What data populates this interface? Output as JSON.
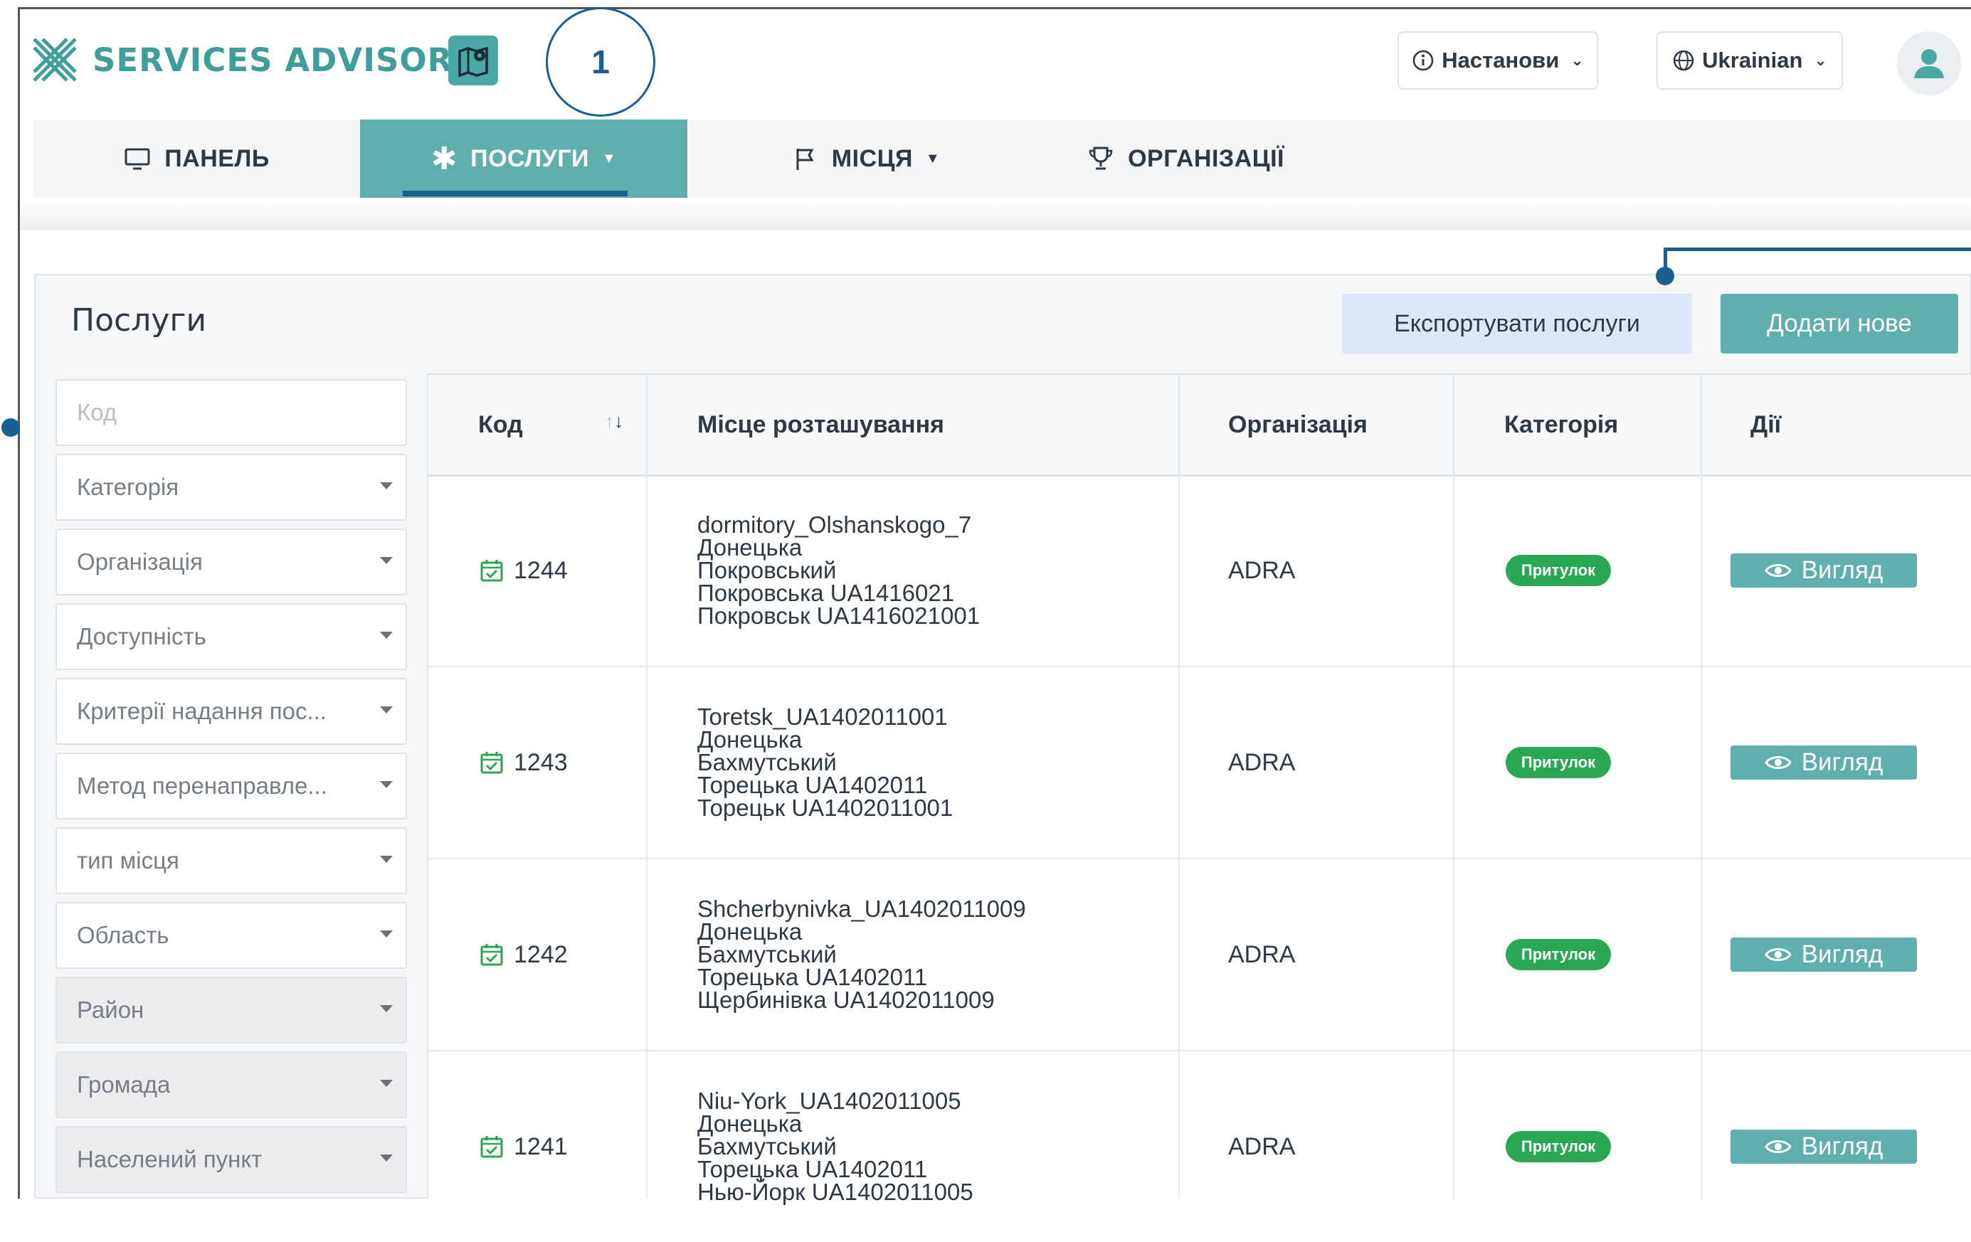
{
  "app": {
    "title": "SERVICES ADVISOR",
    "callout_number": "1"
  },
  "header": {
    "settings_label": "Настанови",
    "language_label": "Ukrainian"
  },
  "nav": {
    "items": [
      {
        "label": "ПАНЕЛЬ",
        "icon": "monitor-icon"
      },
      {
        "label": "ПОСЛУГИ",
        "icon": "asterisk-icon",
        "active": true
      },
      {
        "label": "МІСЦЯ",
        "icon": "flag-icon"
      },
      {
        "label": "ОРГАНІЗАЦІЇ",
        "icon": "trophy-icon"
      }
    ]
  },
  "panel": {
    "title": "Послуги",
    "export_label": "Експортувати послуги",
    "add_label": "Додати нове"
  },
  "filters": [
    {
      "label": "Код",
      "type": "input"
    },
    {
      "label": "Категорія",
      "type": "select"
    },
    {
      "label": "Організація",
      "type": "select"
    },
    {
      "label": "Доступність",
      "type": "select"
    },
    {
      "label": "Критерії надання пос...",
      "type": "select"
    },
    {
      "label": "Метод перенаправле...",
      "type": "select"
    },
    {
      "label": "тип місця",
      "type": "select"
    },
    {
      "label": "Область",
      "type": "select"
    },
    {
      "label": "Район",
      "type": "select",
      "disabled": true
    },
    {
      "label": "Громада",
      "type": "select",
      "disabled": true
    },
    {
      "label": "Населений пункт",
      "type": "select",
      "disabled": true
    }
  ],
  "table": {
    "columns": [
      "Код",
      "Місце розташування",
      "Організація",
      "Категорія",
      "Дії"
    ],
    "rows": [
      {
        "code": "1244",
        "location": [
          "dormitory_Olshanskogo_7",
          "Донецька",
          "Покровський",
          "Покровська UA1416021",
          "Покровськ UA1416021001"
        ],
        "org": "ADRA",
        "category": "Притулок",
        "action": "Вигляд"
      },
      {
        "code": "1243",
        "location": [
          "Toretsk_UA1402011001",
          "Донецька",
          "Бахмутський",
          "Торецька UA1402011",
          "Торецьк UA1402011001"
        ],
        "org": "ADRA",
        "category": "Притулок",
        "action": "Вигляд"
      },
      {
        "code": "1242",
        "location": [
          "Shcherbynivka_UA1402011009",
          "Донецька",
          "Бахмутський",
          "Торецька UA1402011",
          "Щербинівка UA1402011009"
        ],
        "org": "ADRA",
        "category": "Притулок",
        "action": "Вигляд"
      },
      {
        "code": "1241",
        "location": [
          "Niu-York_UA1402011005",
          "Донецька",
          "Бахмутський",
          "Торецька UA1402011",
          "Нью-Йорк UA1402011005"
        ],
        "org": "ADRA",
        "category": "Притулок",
        "action": "Вигляд"
      }
    ]
  },
  "colors": {
    "brand": "#3f9e9b",
    "accent": "#5fb0ad",
    "callout": "#1e5d93",
    "badge": "#2aa752"
  }
}
